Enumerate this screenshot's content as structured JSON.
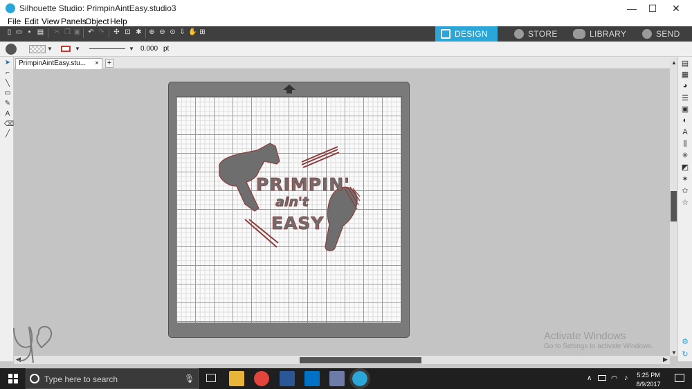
{
  "window": {
    "title": "Silhouette Studio: PrimpinAintEasy.studio3",
    "minimize": "—",
    "maximize": "☐",
    "close": "✕"
  },
  "menu": [
    "File",
    "Edit",
    "View",
    "Panels",
    "Object",
    "Help"
  ],
  "nav_tabs": [
    {
      "label": "DESIGN",
      "active": true
    },
    {
      "label": "STORE",
      "active": false
    },
    {
      "label": "LIBRARY",
      "active": false
    },
    {
      "label": "SEND",
      "active": false
    }
  ],
  "properties": {
    "line_weight": "0.000",
    "unit": "pt"
  },
  "document_tab": {
    "label": "PrimpinAintEasy.stu...",
    "close": "×",
    "add": "+"
  },
  "design": {
    "line1": "PRIMPIN'",
    "line2": "ain't",
    "line3": "EASY"
  },
  "watermark": {
    "line1": "Activate Windows",
    "line2": "Go to Settings to activate Windows."
  },
  "taskbar": {
    "search_placeholder": "Type here to search",
    "time": "5:25 PM",
    "date": "8/9/2017"
  },
  "colors": {
    "accent": "#2aa6d8",
    "toolbar": "#3f3f3f",
    "design_outline": "#8c3b3b"
  }
}
